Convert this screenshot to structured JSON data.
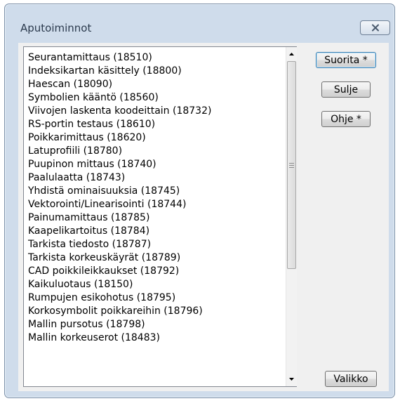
{
  "window": {
    "title": "Aputoiminnot"
  },
  "list": {
    "items": [
      "Seurantamittaus  (18510)",
      "Indeksikartan käsittely  (18800)",
      "Haescan  (18090)",
      "Symbolien kääntö  (18560)",
      "Viivojen laskenta koodeittain  (18732)",
      "RS-portin testaus  (18610)",
      "Poikkarimittaus  (18620)",
      "Latuprofiili  (18780)",
      "Puupinon mittaus  (18740)",
      "Paalulaatta  (18743)",
      "Yhdistä ominaisuuksia  (18745)",
      "Vektorointi/Linearisointi  (18744)",
      "Painumamittaus  (18785)",
      "Kaapelikartoitus  (18784)",
      "Tarkista tiedosto  (18787)",
      "Tarkista korkeuskäyrät  (18789)",
      "CAD poikkileikkaukset  (18792)",
      "Kaikuluotaus  (18150)",
      "Rumpujen esikohotus  (18795)",
      "Korkosymbolit poikkareihin  (18796)",
      "Mallin pursotus  (18798)",
      "Mallin korkeuserot  (18483)"
    ]
  },
  "buttons": {
    "run": "Suorita *",
    "close": "Sulje",
    "help": "Ohje *",
    "menu": "Valikko"
  },
  "icons": {
    "close": "close-x-icon",
    "scroll_up": "arrow-up-icon",
    "scroll_down": "arrow-down-icon",
    "grip": "grip-icon"
  },
  "colors": {
    "frame": "#cfdceb",
    "client": "#f0f0f0",
    "primary_border": "#3c7fb1"
  }
}
